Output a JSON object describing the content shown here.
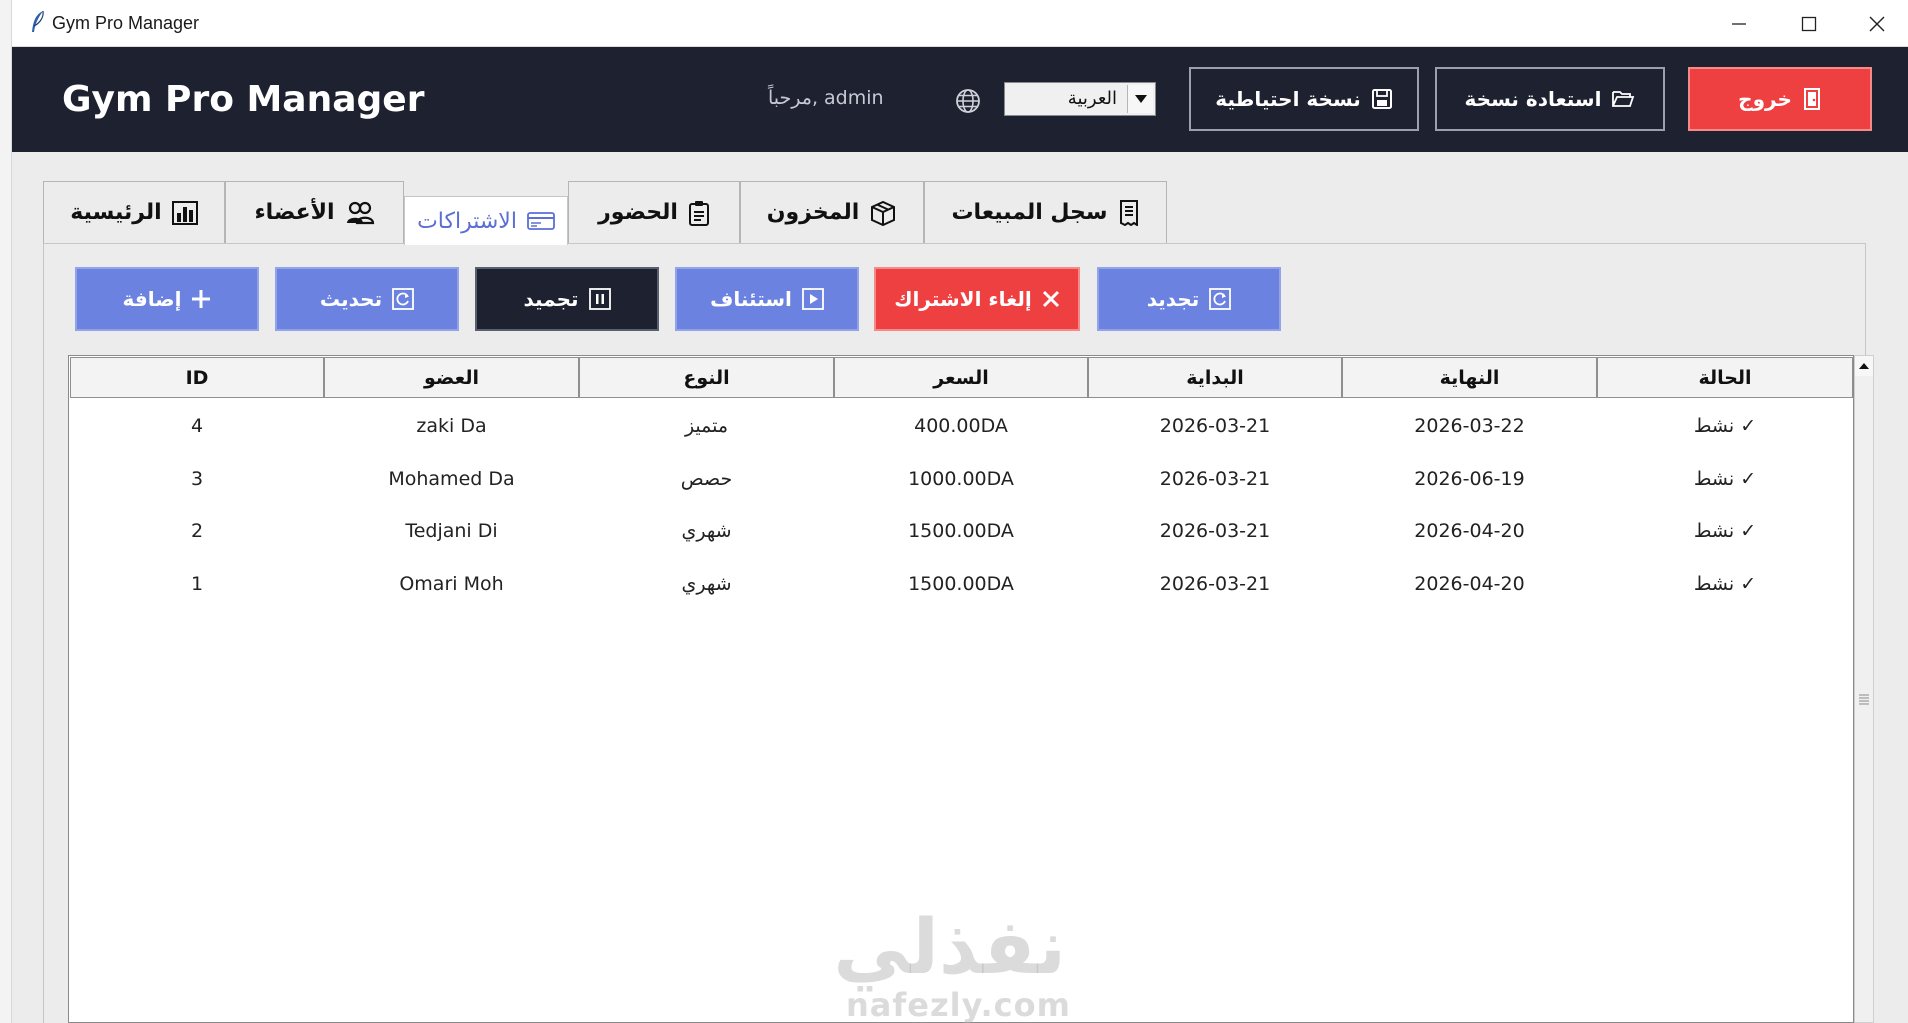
{
  "window": {
    "title": "Gym Pro Manager"
  },
  "header": {
    "brand": "Gym Pro Manager",
    "greeting": "مرحباً, admin",
    "language": "العربية",
    "backup_label": "نسخة احتياطية",
    "restore_label": "استعادة نسخة",
    "logout_label": "خروج"
  },
  "tabs": [
    {
      "label": "الرئيسية"
    },
    {
      "label": "الأعضاء"
    },
    {
      "label": "الاشتراكات"
    },
    {
      "label": "الحضور"
    },
    {
      "label": "المخزون"
    },
    {
      "label": "سجل المبيعات"
    }
  ],
  "actions": {
    "add": "إضافة",
    "refresh": "تحديث",
    "freeze": "تجميد",
    "resume": "استئناف",
    "cancel": "إلغاء الاشتراك",
    "renew": "تجديد"
  },
  "table": {
    "columns": [
      "ID",
      "العضو",
      "النوع",
      "السعر",
      "البداية",
      "النهاية",
      "الحالة"
    ],
    "rows": [
      [
        "4",
        "zaki Da",
        "متميز",
        "400.00DA",
        "2026-03-21",
        "2026-03-22",
        "✓ نشط"
      ],
      [
        "3",
        "Mohamed Da",
        "حصص",
        "1000.00DA",
        "2026-03-21",
        "2026-06-19",
        "✓ نشط"
      ],
      [
        "2",
        "Tedjani Di",
        "شهري",
        "1500.00DA",
        "2026-03-21",
        "2026-04-20",
        "✓ نشط"
      ],
      [
        "1",
        "Omari Moh",
        "شهري",
        "1500.00DA",
        "2026-03-21",
        "2026-04-20",
        "✓ نشط"
      ]
    ]
  },
  "watermark": {
    "arabic": "نفذلي",
    "latin": "nafezly.com"
  },
  "colors": {
    "header_bg": "#1e2130",
    "accent_blue": "#6c82e0",
    "danger_red": "#ee4040"
  }
}
